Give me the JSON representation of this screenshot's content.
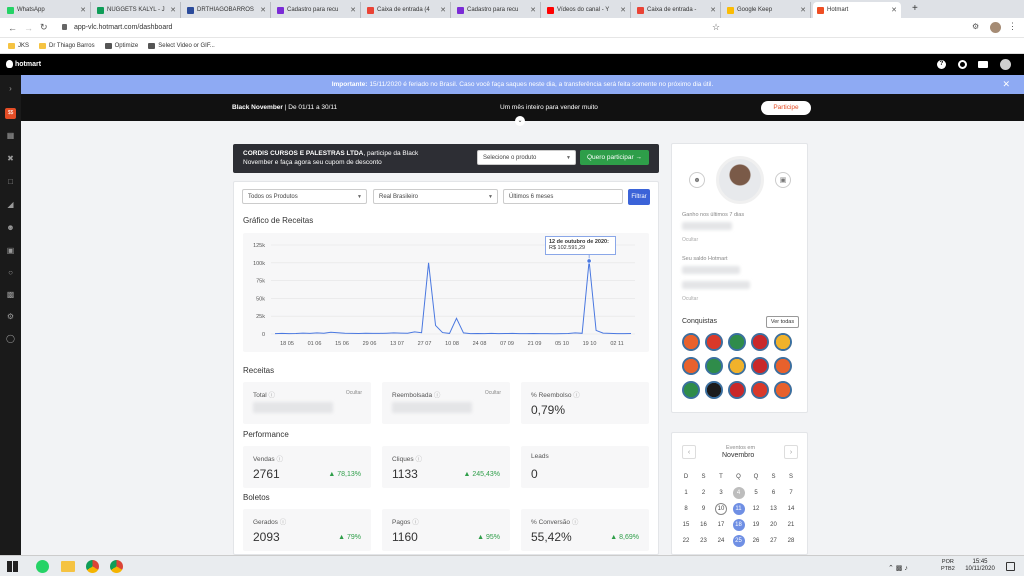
{
  "browser": {
    "tabs": [
      {
        "label": "WhatsApp",
        "color": "#25d366"
      },
      {
        "label": "NUGGETS KALYL - J",
        "color": "#0f9d58"
      },
      {
        "label": "DRTHIAGOBARROS",
        "color": "#2b4b9b"
      },
      {
        "label": "Cadastro para recu",
        "color": "#7b2bd6"
      },
      {
        "label": "Caixa de entrada (4",
        "color": "#ea4335"
      },
      {
        "label": "Cadastro para recu",
        "color": "#7b2bd6"
      },
      {
        "label": "Vídeos do canal - Y",
        "color": "#ff0000"
      },
      {
        "label": "Caixa de entrada -",
        "color": "#ea4335"
      },
      {
        "label": "Google Keep",
        "color": "#fbbc04"
      },
      {
        "label": "Hotmart",
        "color": "#ef4e23"
      }
    ],
    "url": "app-vlc.hotmart.com/dashboard",
    "bookmarks": [
      "JKS",
      "Dr Thiago Barros",
      "Optimize",
      "Select Video or GIF..."
    ]
  },
  "app": {
    "logo": "hotmart",
    "notice_bold": "Importante:",
    "notice_text": " 15/11/2020 é feriado no Brasil. Caso você faça saques neste dia, a transferência será feita somente no próximo dia útil.",
    "banner_left_bold": "Black November",
    "banner_left": " | De 01/11 a 30/11",
    "banner_center": "Um mês inteiro para vender muito",
    "banner_button": "Participe"
  },
  "promo": {
    "text_bold": "CORDIS CURSOS E PALESTRAS LTDA",
    "text": ", participe da Black November e faça agora seu cupom de desconto",
    "select_placeholder": "Selecione o produto",
    "button": "Quero participar"
  },
  "filters": {
    "products": "Todos os Produtos",
    "currency": "Real Brasileiro",
    "period": "Últimos 6 meses",
    "button": "Filtrar"
  },
  "chart_title": "Gráfico de Receitas",
  "chart_data": {
    "type": "line",
    "x": [
      "18 05",
      "01 06",
      "15 06",
      "29 06",
      "13 07",
      "27 07",
      "10 08",
      "24 08",
      "07 09",
      "21 09",
      "05 10",
      "19 10",
      "02 11"
    ],
    "y_ticks": [
      "125k",
      "100k",
      "75k",
      "50k",
      "25k",
      "0"
    ],
    "ylim": [
      0,
      125000
    ],
    "series": [
      {
        "values": [
          500,
          800,
          600,
          700,
          1200,
          900,
          1500,
          1100,
          2500,
          1800,
          1000,
          900,
          700,
          1000,
          800,
          900,
          1100,
          1500,
          1300,
          1000,
          3000,
          1800,
          100000,
          12000,
          2000,
          800,
          22000,
          1500,
          600,
          700,
          500,
          900,
          600,
          700,
          800,
          500,
          600,
          700,
          500,
          600,
          400,
          500,
          700,
          1600,
          1000,
          102591,
          5000,
          1200,
          800,
          600,
          500,
          700
        ]
      }
    ],
    "tooltip_date": "12 de outubro de 2020:",
    "tooltip_value": "R$ 102.591,29"
  },
  "receitas": {
    "title": "Receitas",
    "total_label": "Total",
    "total_hint": "Ocultar",
    "reembolsada_label": "Reembolsada",
    "reembolsada_hint": "Ocultar",
    "reembolso_label": "% Reembolso",
    "reembolso_value": "0,79%"
  },
  "performance": {
    "title": "Performance",
    "vendas_label": "Vendas",
    "vendas_value": "2761",
    "vendas_trend": "78,13%",
    "cliques_label": "Cliques",
    "cliques_value": "1133",
    "cliques_trend": "245,43%",
    "leads_label": "Leads",
    "leads_value": "0"
  },
  "boletos": {
    "title": "Boletos",
    "gerados_label": "Gerados",
    "gerados_value": "2093",
    "gerados_trend": "79%",
    "pagos_label": "Pagos",
    "pagos_value": "1160",
    "pagos_trend": "95%",
    "conversao_label": "% Conversão",
    "conversao_value": "55,42%",
    "conversao_trend": "8,69%"
  },
  "sidebar": {
    "ganho_label": "Ganho nos últimos 7 dias",
    "ganho_hint": "Ocultar",
    "saldo_label": "Seu saldo Hotmart",
    "saldo_hint": "Ocultar",
    "conquistas": "Conquistas",
    "ver_todas": "Ver todas"
  },
  "calendar": {
    "subtitle": "Eventos em",
    "month": "Novembro",
    "weekdays": [
      "D",
      "S",
      "T",
      "Q",
      "Q",
      "S",
      "S"
    ],
    "days": [
      [
        "",
        "",
        "",
        "",
        "",
        "",
        ""
      ],
      [
        "1",
        "2",
        "3",
        "4",
        "5",
        "6",
        "7"
      ],
      [
        "8",
        "9",
        "10",
        "11",
        "12",
        "13",
        "14"
      ],
      [
        "15",
        "16",
        "17",
        "18",
        "19",
        "20",
        "21"
      ],
      [
        "22",
        "23",
        "24",
        "25",
        "26",
        "27",
        "28"
      ]
    ]
  },
  "taskbar": {
    "lang": "POR",
    "layout": "PTB2",
    "time": "15:45",
    "date": "10/11/2020"
  }
}
